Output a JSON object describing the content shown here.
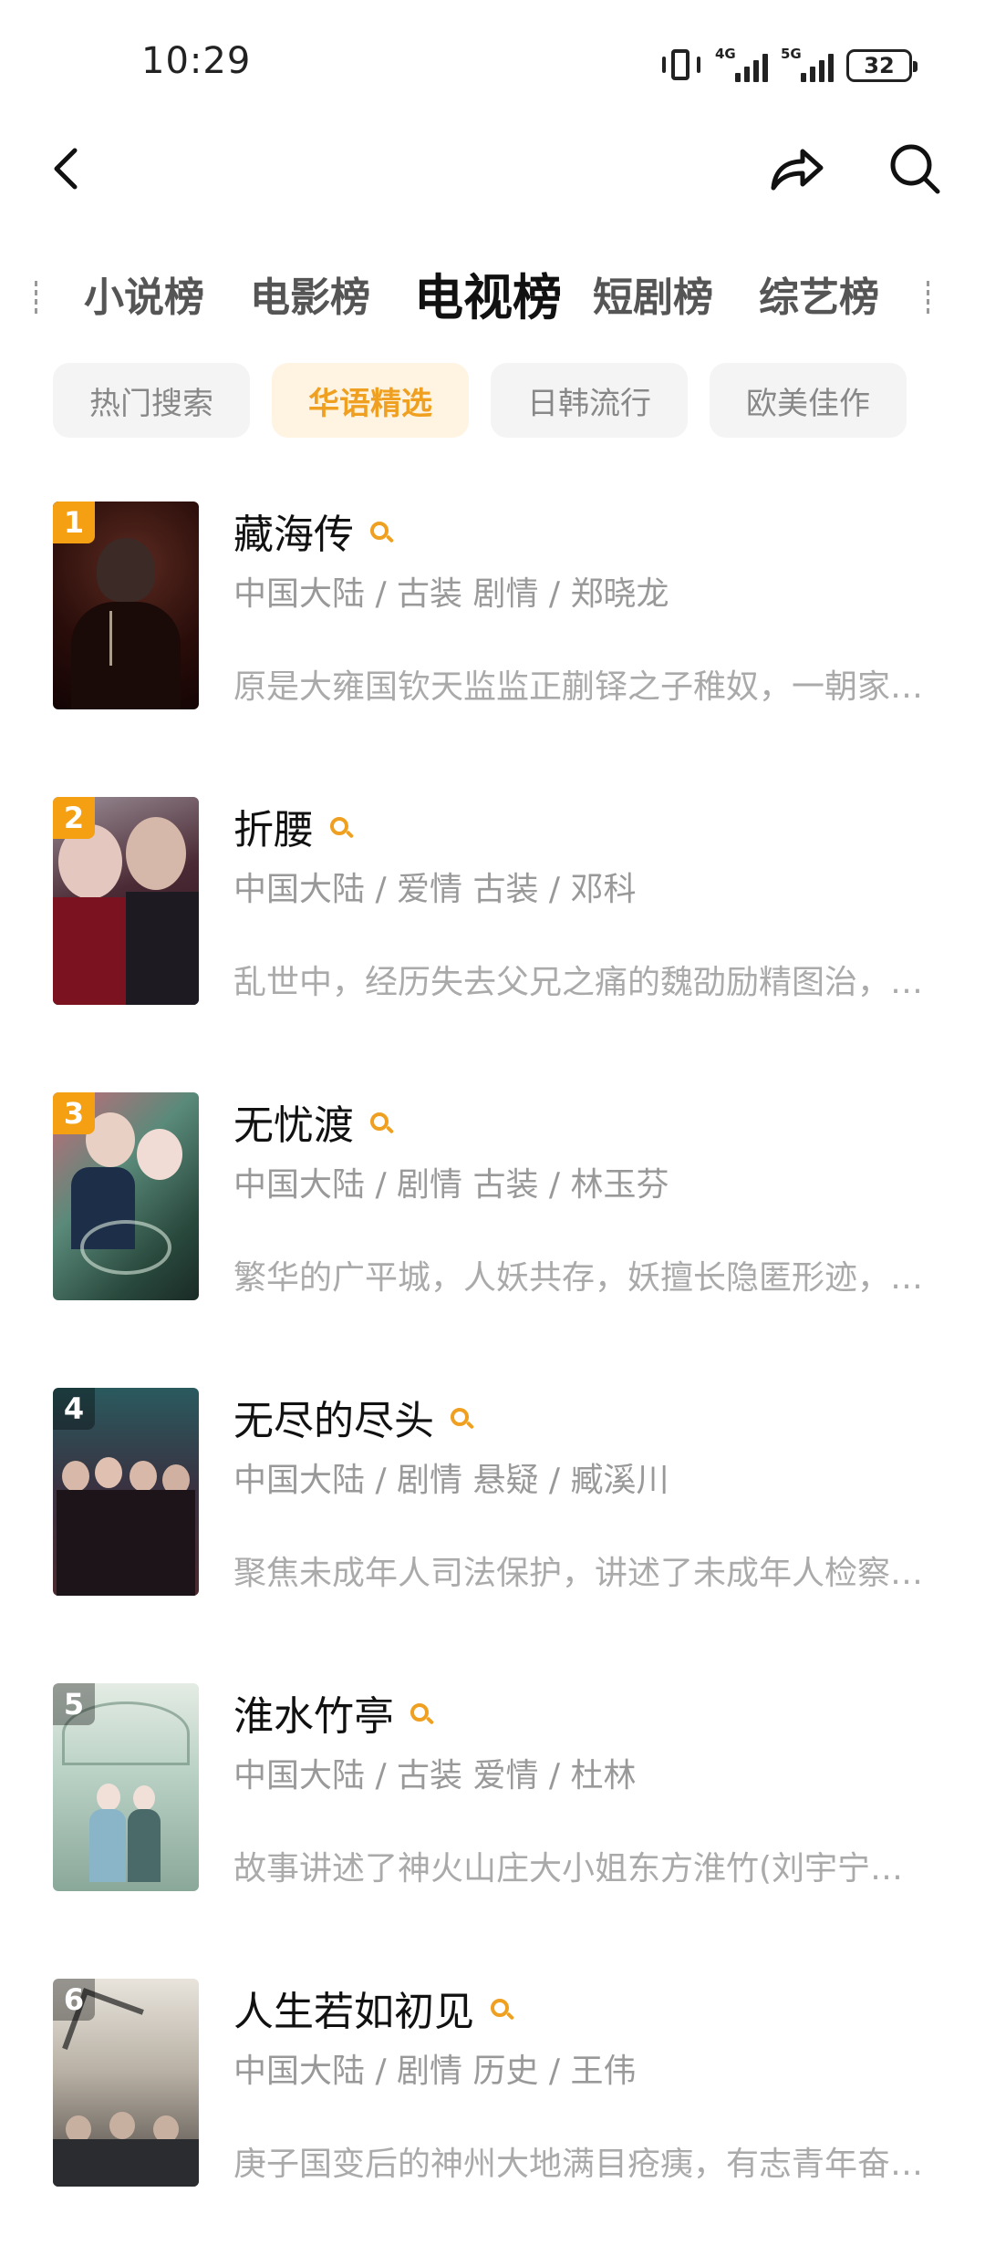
{
  "status": {
    "time": "10:29",
    "net1": "4G",
    "net2": "5G",
    "battery": "32"
  },
  "categories": [
    {
      "label": "小说榜",
      "active": false
    },
    {
      "label": "电影榜",
      "active": false
    },
    {
      "label": "电视榜",
      "active": true
    },
    {
      "label": "短剧榜",
      "active": false
    },
    {
      "label": "综艺榜",
      "active": false
    }
  ],
  "sub_tabs": [
    {
      "label": "热门搜索",
      "active": false
    },
    {
      "label": "华语精选",
      "active": true
    },
    {
      "label": "日韩流行",
      "active": false
    },
    {
      "label": "欧美佳作",
      "active": false
    }
  ],
  "colors": {
    "accent": "#f0a021",
    "rank_top": "#f5a013"
  },
  "items": [
    {
      "rank": "1",
      "title": "藏海传",
      "meta": "中国大陆 / 古装 剧情 / 郑晓龙",
      "desc": "原是大雍国钦天监监正蒯铎之子稚奴，一朝家族被灭门，隐姓埋名十年后以藏海之名入京复仇"
    },
    {
      "rank": "2",
      "title": "折腰",
      "meta": "中国大陆 / 爱情 古装 / 邓科",
      "desc": "乱世中，经历失去父兄之痛的魏劭励精图治，为报家仇与乔家联姻"
    },
    {
      "rank": "3",
      "title": "无忧渡",
      "meta": "中国大陆 / 剧情 古装 / 林玉芬",
      "desc": "繁华的广平城，人妖共存，妖擅长隐匿形迹，伪装成人的模样生活"
    },
    {
      "rank": "4",
      "title": "无尽的尽头",
      "meta": "中国大陆 / 剧情 悬疑 / 臧溪川",
      "desc": "聚焦未成年人司法保护，讲述了未成年人检察官的故事"
    },
    {
      "rank": "5",
      "title": "淮水竹亭",
      "meta": "中国大陆 / 古装 爱情 / 杜林",
      "desc": "故事讲述了神火山庄大小姐东方淮竹(刘宇宁饰)的故事"
    },
    {
      "rank": "6",
      "title": "人生若如初见",
      "meta": "中国大陆 / 剧情 历史 / 王伟",
      "desc": "庚子国变后的神州大地满目疮痍，有志青年奋起救国"
    }
  ]
}
